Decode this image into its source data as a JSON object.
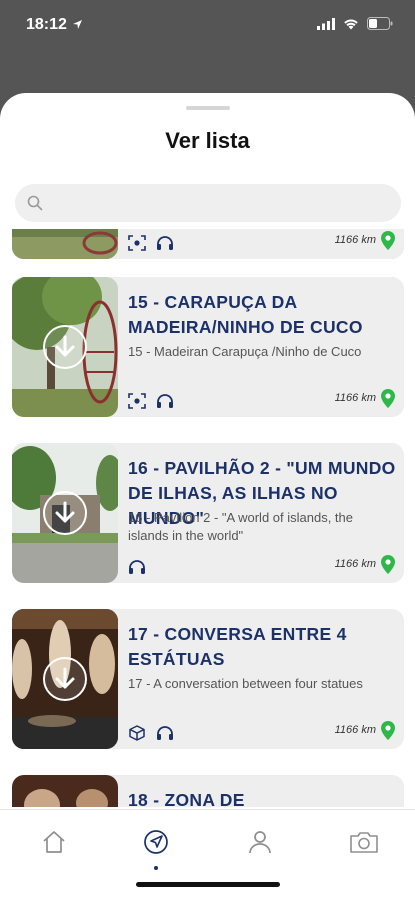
{
  "status_bar": {
    "time": "18:12"
  },
  "sheet": {
    "title": "Ver lista"
  },
  "search": {
    "placeholder": ""
  },
  "items": [
    {
      "title": "",
      "subtitle": "",
      "distance": "1166 km",
      "icons": [
        "ar-icon",
        "headphones-icon"
      ]
    },
    {
      "title": "15 - CARAPUÇA DA MADEIRA/NINHO DE CUCO",
      "subtitle": "15 - Madeiran Carapuça /Ninho de Cuco",
      "distance": "1166 km",
      "icons": [
        "ar-icon",
        "headphones-icon"
      ]
    },
    {
      "title": "16 - PAVILHÃO 2 - \"UM MUNDO DE ILHAS, AS ILHAS NO MUNDO\"",
      "subtitle": "16 - Pavilion 2 - \"A world of islands, the islands in the world\"",
      "distance": "1166 km",
      "icons": [
        "headphones-icon"
      ]
    },
    {
      "title": "17 - CONVERSA ENTRE 4 ESTÁTUAS",
      "subtitle": "17 - A conversation between four statues",
      "distance": "1166 km",
      "icons": [
        "cube-icon",
        "headphones-icon"
      ]
    },
    {
      "title": "18 - ZONA DE",
      "subtitle": "",
      "distance": "",
      "icons": []
    }
  ],
  "tabbar": {
    "tabs": [
      {
        "name": "home",
        "icon": "home-icon"
      },
      {
        "name": "explore",
        "icon": "navigation-icon",
        "active": true
      },
      {
        "name": "profile",
        "icon": "user-icon"
      },
      {
        "name": "camera",
        "icon": "camera-icon"
      }
    ]
  },
  "colors": {
    "title": "#1c3168",
    "pin": "#2eb84a",
    "card": "#eeeeee"
  }
}
